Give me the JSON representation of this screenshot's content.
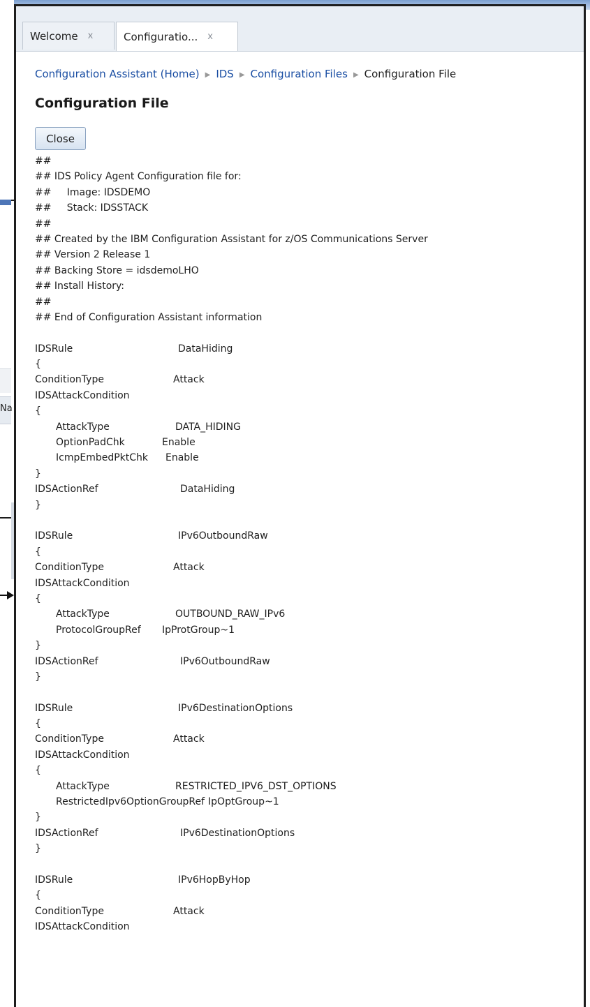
{
  "tabs": [
    {
      "label": "Welcome",
      "close": "x"
    },
    {
      "label": "Configuratio...",
      "close": "x"
    }
  ],
  "background": {
    "partial_label": "Na"
  },
  "breadcrumb": {
    "items": [
      "Configuration Assistant (Home)",
      "IDS",
      "Configuration Files"
    ],
    "current": "Configuration File"
  },
  "page_title": "Configuration File",
  "close_label": "Close",
  "header_lines": [
    "##",
    "## IDS Policy Agent Configuration file for:",
    "##     Image: IDSDEMO",
    "##     Stack: IDSSTACK",
    "##",
    "## Created by the IBM Configuration Assistant for z/OS Communications Server",
    "## Version 2 Release 1",
    "## Backing Store = idsdemoLHO",
    "## Install History:",
    "##",
    "## End of Configuration Assistant information"
  ],
  "rules": [
    {
      "rule_key": "IDSRule",
      "rule_value": "DataHiding",
      "open": "{",
      "cond_key": "ConditionType",
      "cond_value": "Attack",
      "attack_cond": "IDSAttackCondition",
      "inner_open": "{",
      "params": [
        {
          "key": "AttackType",
          "value": "DATA_HIDING"
        },
        {
          "key": "OptionPadChk",
          "value": "Enable"
        },
        {
          "key": "IcmpEmbedPktChk",
          "value": "Enable"
        }
      ],
      "inner_close": "}",
      "action_key": "IDSActionRef",
      "action_value": "DataHiding",
      "close": "}"
    },
    {
      "rule_key": "IDSRule",
      "rule_value": "IPv6OutboundRaw",
      "open": "{",
      "cond_key": "ConditionType",
      "cond_value": "Attack",
      "attack_cond": "IDSAttackCondition",
      "inner_open": "{",
      "params": [
        {
          "key": "AttackType",
          "value": "OUTBOUND_RAW_IPv6"
        },
        {
          "key": "ProtocolGroupRef",
          "value": "IpProtGroup~1"
        }
      ],
      "inner_close": "}",
      "action_key": "IDSActionRef",
      "action_value": "IPv6OutboundRaw",
      "close": "}"
    },
    {
      "rule_key": "IDSRule",
      "rule_value": "IPv6DestinationOptions",
      "open": "{",
      "cond_key": "ConditionType",
      "cond_value": "Attack",
      "attack_cond": "IDSAttackCondition",
      "inner_open": "{",
      "params": [
        {
          "key": "AttackType",
          "value": "RESTRICTED_IPV6_DST_OPTIONS"
        },
        {
          "key": "RestrictedIpv6OptionGroupRef",
          "value": "IpOptGroup~1"
        }
      ],
      "inner_close": "}",
      "action_key": "IDSActionRef",
      "action_value": "IPv6DestinationOptions",
      "close": "}"
    },
    {
      "rule_key": "IDSRule",
      "rule_value": "IPv6HopByHop",
      "open": "{",
      "cond_key": "ConditionType",
      "cond_value": "Attack",
      "attack_cond": "IDSAttackCondition"
    }
  ]
}
